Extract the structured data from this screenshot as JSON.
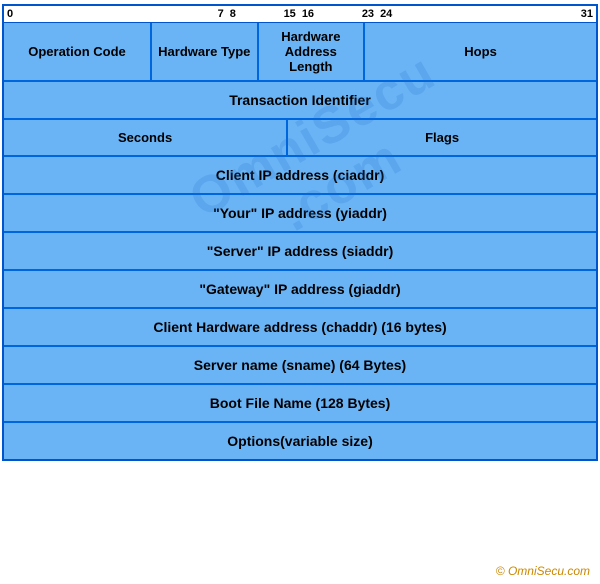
{
  "header": {
    "bits": [
      "0",
      "7",
      "8",
      "15",
      "16",
      "23",
      "24",
      "31"
    ]
  },
  "rows": {
    "row1": {
      "c1": "Operation Code",
      "c2": "Hardware Type",
      "c3": "Hardware\nAddress Length",
      "c4": "Hops"
    },
    "row2": "Transaction Identifier",
    "row3": {
      "left": "Seconds",
      "right": "Flags"
    },
    "row4": "Client IP address (ciaddr)",
    "row5": "\"Your\" IP address (yiaddr)",
    "row6": "\"Server\" IP address (siaddr)",
    "row7": "\"Gateway\" IP address (giaddr)",
    "row8": "Client Hardware address (chaddr) (16 bytes)",
    "row9": "Server name (sname) (64 Bytes)",
    "row10": "Boot File Name (128 Bytes)",
    "row11": "Options(variable size)"
  },
  "watermark": {
    "line1": "OmniSecu",
    "line2": ".com"
  },
  "copyright": "© OmniSecu.com"
}
